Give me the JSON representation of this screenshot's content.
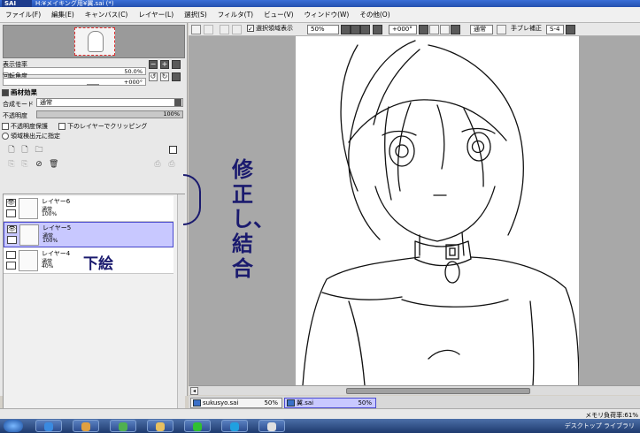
{
  "titlebar": {
    "logo": "SAI",
    "title": "H:¥メイキング用¥翼.sai (*)"
  },
  "menu": [
    "ファイル(F)",
    "編集(E)",
    "キャンバス(C)",
    "レイヤー(L)",
    "選択(S)",
    "フィルタ(T)",
    "ビュー(V)",
    "ウィンドウ(W)",
    "その他(O)"
  ],
  "navigator": {
    "zoom_label": "表示倍率",
    "zoom_value": "50.0%",
    "rotate_label": "回転角度",
    "rotate_value": "+000°"
  },
  "layer_props": {
    "title": "画材効果",
    "blend_label": "合成モード",
    "blend_value": "通常",
    "opacity_label": "不透明度",
    "opacity_value": "100%",
    "preserve_opacity": "不透明度保護",
    "clip_group": "下のレイヤーでクリッピング",
    "selection_source": "領域検出元に指定"
  },
  "layers": [
    {
      "name": "レイヤー6",
      "mode": "通常",
      "opacity": "100%"
    },
    {
      "name": "レイヤー5",
      "mode": "通常",
      "opacity": "100%"
    },
    {
      "name": "レイヤー4",
      "mode": "通常",
      "opacity": "40%"
    }
  ],
  "annotations": {
    "draft": "下絵",
    "fix_merge": "修正し、結合"
  },
  "canvas_toolbar": {
    "show_selection": "選択領域表示",
    "zoom": "50%",
    "angle": "+000°",
    "mode": "通常",
    "stabilizer_label": "手ブレ補正",
    "stabilizer_value": "S-4"
  },
  "tabs": [
    {
      "name": "sukusyo.sai",
      "zoom": "50%"
    },
    {
      "name": "翼.sai",
      "zoom": "50%"
    }
  ],
  "status": {
    "memory": "メモリ負荷率:61%"
  },
  "taskbar": {
    "tray": "デスクトップ ライブラリ"
  }
}
